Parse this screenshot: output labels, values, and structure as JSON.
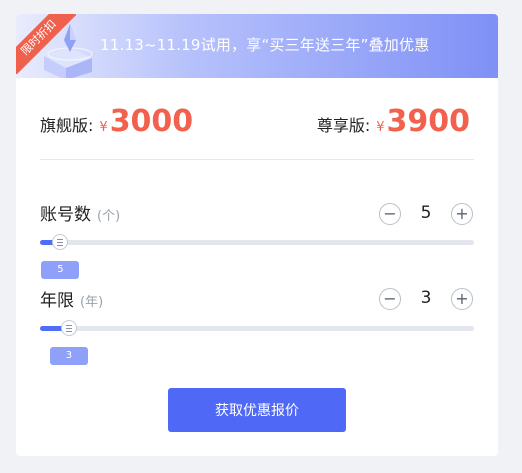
{
  "banner": {
    "ribbon": "限时折扣",
    "text": "11.13~11.19试用，享“买三年送三年”叠加优惠"
  },
  "pricing": {
    "flagship": {
      "label": "旗舰版:",
      "currency": "¥",
      "amount": "3000"
    },
    "premium": {
      "label": "尊享版:",
      "currency": "¥",
      "amount": "3900"
    }
  },
  "accounts": {
    "title": "账号数",
    "unit": "(个)",
    "value": "5",
    "tip": "5",
    "minus": "−",
    "plus": "+",
    "fill_fraction": 0.02
  },
  "years": {
    "title": "年限",
    "unit": "(年)",
    "value": "3",
    "tip": "3",
    "minus": "−",
    "plus": "+",
    "fill_fraction": 0.04
  },
  "cta": {
    "label": "获取优惠报价"
  },
  "colors": {
    "accent": "#5068f6",
    "price": "#f2614d",
    "ribbon": "#f0614d"
  }
}
